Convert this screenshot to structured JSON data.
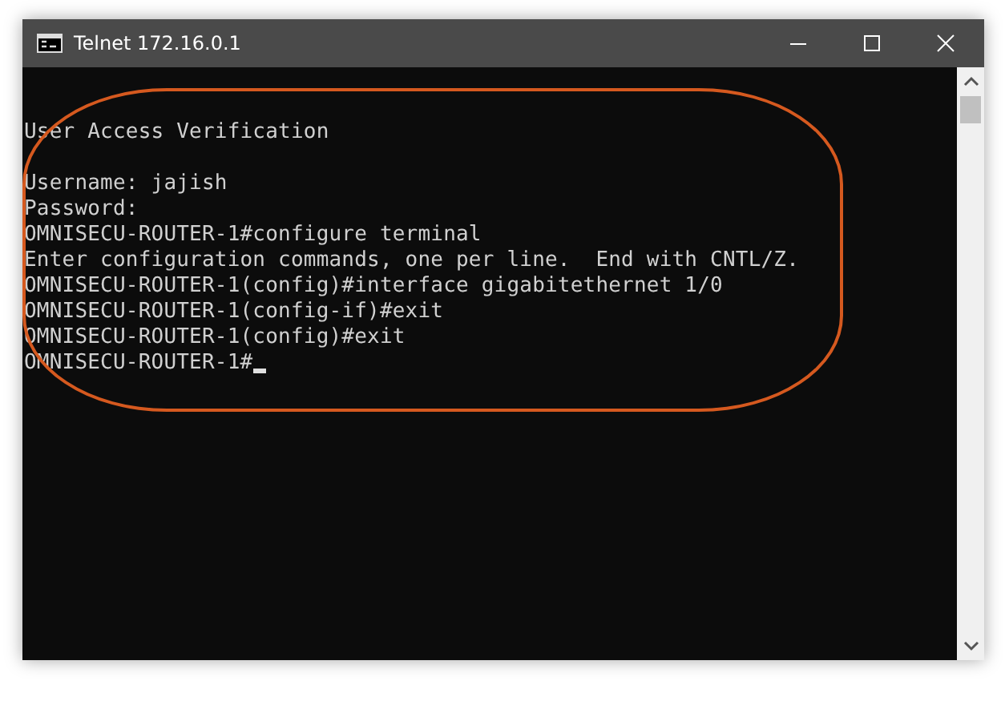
{
  "window": {
    "title": "Telnet 172.16.0.1"
  },
  "terminal": {
    "blocks": [
      [
        "User Access Verification"
      ],
      [
        "Username: jajish",
        "Password:",
        "OMNISECU-ROUTER-1#configure terminal",
        "Enter configuration commands, one per line.  End with CNTL/Z.",
        "OMNISECU-ROUTER-1(config)#interface gigabitethernet 1/0",
        "OMNISECU-ROUTER-1(config-if)#exit",
        "OMNISECU-ROUTER-1(config)#exit",
        "OMNISECU-ROUTER-1#"
      ]
    ],
    "cursor": true
  }
}
